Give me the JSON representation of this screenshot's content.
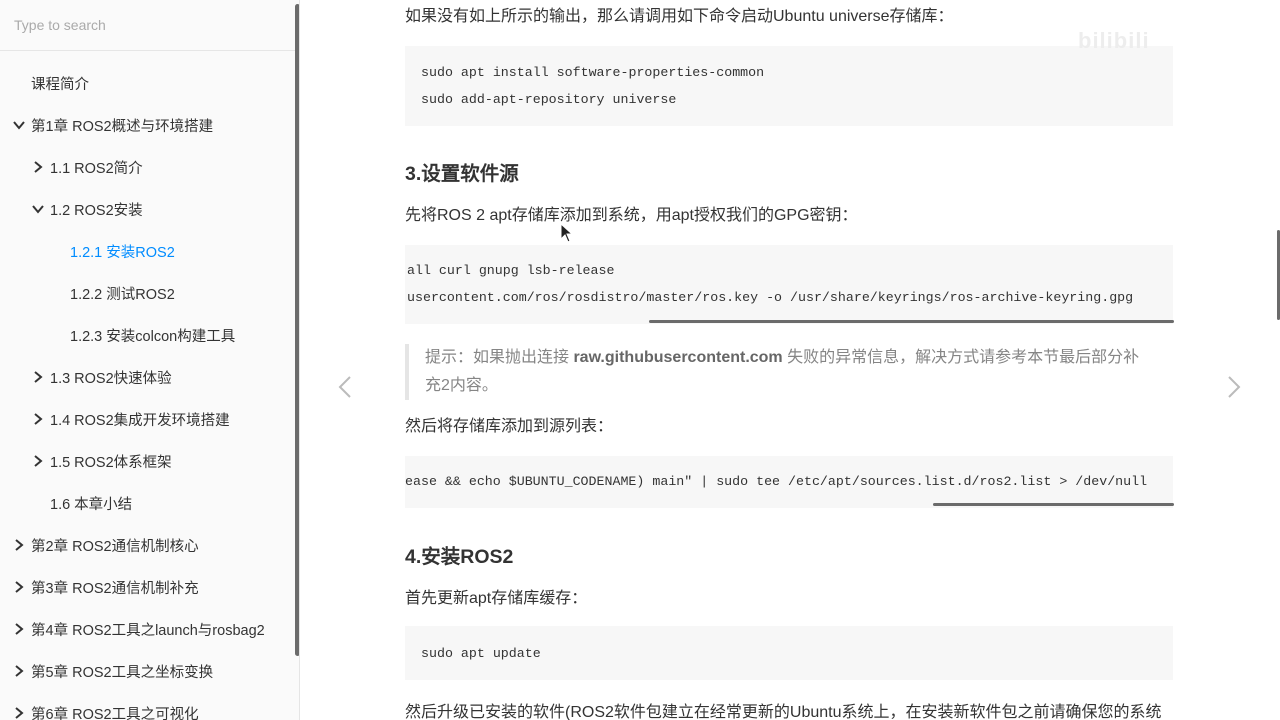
{
  "search": {
    "placeholder": "Type to search"
  },
  "sidebar": {
    "items": [
      {
        "label": "课程简介",
        "chevron": "none"
      },
      {
        "label": "第1章 ROS2概述与环境搭建",
        "chevron": "down"
      },
      {
        "label": "1.1 ROS2简介",
        "chevron": "right"
      },
      {
        "label": "1.2 ROS2安装",
        "chevron": "down"
      },
      {
        "label": "1.2.1 安装ROS2",
        "chevron": "none",
        "active": true
      },
      {
        "label": "1.2.2 测试ROS2",
        "chevron": "none"
      },
      {
        "label": "1.2.3 安装colcon构建工具",
        "chevron": "none"
      },
      {
        "label": "1.3 ROS2快速体验",
        "chevron": "right"
      },
      {
        "label": "1.4 ROS2集成开发环境搭建",
        "chevron": "right"
      },
      {
        "label": "1.5 ROS2体系框架",
        "chevron": "right"
      },
      {
        "label": "1.6 本章小结",
        "chevron": "none"
      },
      {
        "label": "第2章 ROS2通信机制核心",
        "chevron": "right"
      },
      {
        "label": "第3章 ROS2通信机制补充",
        "chevron": "right"
      },
      {
        "label": "第4章 ROS2工具之launch与rosbag2",
        "chevron": "right"
      },
      {
        "label": "第5章 ROS2工具之坐标变换",
        "chevron": "right"
      },
      {
        "label": "第6章 ROS2工具之可视化",
        "chevron": "right"
      }
    ]
  },
  "content": {
    "p1": "如果没有如上所示的输出，那么请调用如下命令启动Ubuntu universe存储库：",
    "code1": "sudo apt install software-properties-common\nsudo add-apt-repository universe",
    "h3": "3.设置软件源",
    "p2": "先将ROS 2 apt存储库添加到系统，用apt授权我们的GPG密钥：",
    "code2": "all curl gnupg lsb-release\nusercontent.com/ros/rosdistro/master/ros.key -o /usr/share/keyrings/ros-archive-keyring.gpg",
    "tip_prefix": "提示：如果抛出连接 ",
    "tip_bold": "raw.githubusercontent.com",
    "tip_suffix": " 失败的异常信息，解决方式请参考本节最后部分补",
    "tip_line2": "充2内容。",
    "p3": "然后将存储库添加到源列表：",
    "code3": "ease && echo $UBUNTU_CODENAME) main\" | sudo tee /etc/apt/sources.list.d/ros2.list > /dev/null",
    "h4": "4.安装ROS2",
    "p4": "首先更新apt存储库缓存：",
    "code4": "sudo apt update",
    "p5": "然后升级已安装的软件(ROS2软件包建立在经常更新的Ubuntu系统上，在安装新软件包之前请确保您的系统"
  },
  "icons": {
    "prev": "chevron-left-icon",
    "next": "chevron-right-icon"
  },
  "colors": {
    "accent": "#008cff",
    "code_bg": "#f7f7f7"
  }
}
